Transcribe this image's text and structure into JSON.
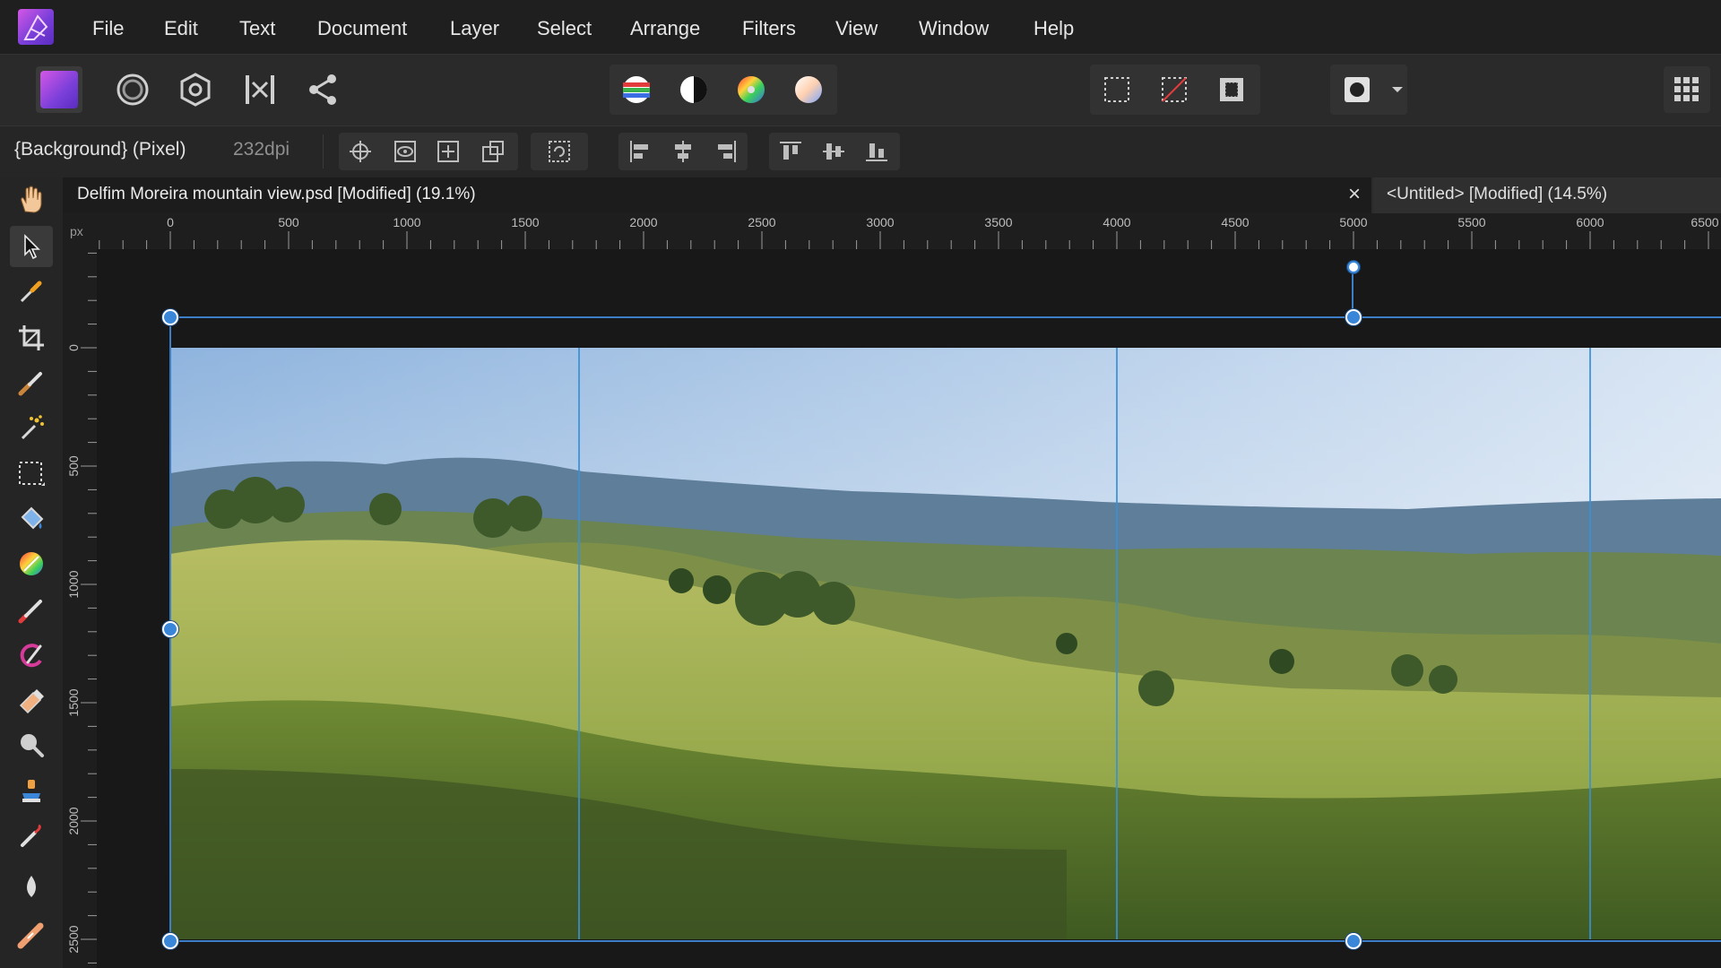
{
  "menu": [
    "File",
    "Edit",
    "Text",
    "Document",
    "Layer",
    "Select",
    "Arrange",
    "Filters",
    "View",
    "Window",
    "Help"
  ],
  "toolbar": {
    "personas": [
      "photo-persona-icon",
      "liquify-persona-icon",
      "develop-persona-icon",
      "tone-mapping-persona-icon",
      "export-persona-icon"
    ],
    "adjust": [
      "auto-levels-icon",
      "auto-contrast-icon",
      "auto-colors-icon",
      "auto-white-balance-icon"
    ],
    "selection": [
      "marquee-select-icon",
      "deselect-icon",
      "invert-selection-icon"
    ],
    "mask": "quick-mask-icon",
    "snapping": "snapping-icon"
  },
  "context": {
    "layer_label": "{Background} (Pixel)",
    "dpi": "232dpi"
  },
  "tabs": {
    "active": "Delfim Moreira mountain view.psd [Modified] (19.1%)",
    "close": "×",
    "inactive": "<Untitled> [Modified] (14.5%)"
  },
  "ruler": {
    "unit": "px",
    "top_labels": [
      "0",
      "500",
      "1000",
      "1500",
      "2000",
      "2500",
      "3000",
      "3500",
      "4000",
      "4500",
      "5000",
      "5500",
      "6000",
      "6500"
    ],
    "left_labels": [
      "0",
      "500",
      "1000",
      "1500",
      "2000",
      "2500"
    ]
  },
  "tools": [
    "view-tool-icon",
    "move-tool-icon",
    "color-picker-icon",
    "crop-tool-icon",
    "selection-brush-icon",
    "flood-select-icon",
    "marquee-tool-icon",
    "flood-fill-icon",
    "gradient-tool-icon",
    "paint-brush-icon",
    "color-replacement-icon",
    "erase-brush-icon",
    "dodge-tool-icon",
    "clone-tool-icon",
    "blemish-removal-icon",
    "blur-tool-icon",
    "inpainting-icon"
  ],
  "colors": {
    "accent": "#3a86d8",
    "guide": "#3a8fd6",
    "background": "#1e1e1e"
  }
}
